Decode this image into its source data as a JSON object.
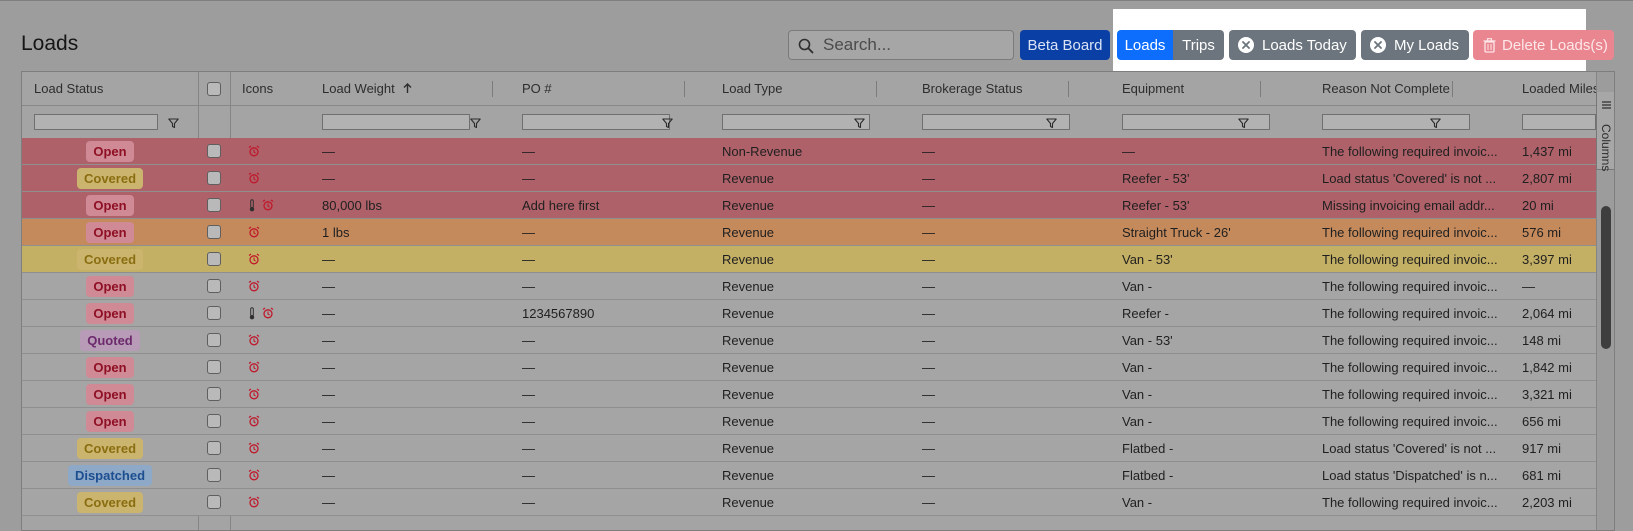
{
  "page": {
    "title": "Loads"
  },
  "search": {
    "placeholder": "Search..."
  },
  "toolbar": {
    "beta_board": "Beta Board",
    "segment": {
      "loads": "Loads",
      "trips": "Trips"
    },
    "loads_today": "Loads Today",
    "my_loads": "My Loads",
    "delete_loads": "Delete Loads(s)"
  },
  "grid": {
    "columns": {
      "load_status": "Load Status",
      "icons": "Icons",
      "load_weight": "Load Weight",
      "po": "PO #",
      "load_type": "Load Type",
      "brokerage_status": "Brokerage Status",
      "equipment": "Equipment",
      "reason_not_complete": "Reason Not Complete",
      "loaded_miles": "Loaded Miles"
    },
    "side_panel": "Columns",
    "rows": [
      {
        "status": "Open",
        "status_kind": "open",
        "bg": "#ae6169",
        "icons": [
          "alarm"
        ],
        "weight": "—",
        "po": "—",
        "load_type": "Non-Revenue",
        "brokerage": "—",
        "equipment": "—",
        "reason": "The following required invoic...",
        "miles": "1,437 mi"
      },
      {
        "status": "Covered",
        "status_kind": "covered",
        "bg": "#ae6169",
        "icons": [
          "alarm"
        ],
        "weight": "—",
        "po": "—",
        "load_type": "Revenue",
        "brokerage": "—",
        "equipment": "Reefer - 53'",
        "reason": "Load status 'Covered' is not ...",
        "miles": "2,807 mi"
      },
      {
        "status": "Open",
        "status_kind": "open",
        "bg": "#ae6169",
        "icons": [
          "thermometer",
          "alarm"
        ],
        "weight": "80,000 lbs",
        "po": "Add here first",
        "load_type": "Revenue",
        "brokerage": "—",
        "equipment": "Reefer - 53'",
        "reason": "Missing invoicing email addr...",
        "miles": "20 mi"
      },
      {
        "status": "Open",
        "status_kind": "open",
        "bg": "#c48a5c",
        "icons": [
          "alarm"
        ],
        "weight": "1 lbs",
        "po": "—",
        "load_type": "Revenue",
        "brokerage": "—",
        "equipment": "Straight Truck - 26'",
        "reason": "The following required invoic...",
        "miles": "576 mi"
      },
      {
        "status": "Covered",
        "status_kind": "covered",
        "bg": "#c4b064",
        "icons": [
          "alarm"
        ],
        "weight": "—",
        "po": "—",
        "load_type": "Revenue",
        "brokerage": "—",
        "equipment": "Van - 53'",
        "reason": "The following required invoic...",
        "miles": "3,397 mi"
      },
      {
        "status": "Open",
        "status_kind": "open",
        "bg": "#a5a5a5",
        "icons": [
          "alarm"
        ],
        "weight": "—",
        "po": "—",
        "load_type": "Revenue",
        "brokerage": "—",
        "equipment": "Van -",
        "reason": "The following required invoic...",
        "miles": "—"
      },
      {
        "status": "Open",
        "status_kind": "open",
        "bg": "#a5a5a5",
        "icons": [
          "thermometer",
          "alarm"
        ],
        "weight": "—",
        "po": "1234567890",
        "load_type": "Revenue",
        "brokerage": "—",
        "equipment": "Reefer -",
        "reason": "The following required invoic...",
        "miles": "2,064 mi"
      },
      {
        "status": "Quoted",
        "status_kind": "quoted",
        "bg": "#a5a5a5",
        "icons": [
          "alarm"
        ],
        "weight": "—",
        "po": "—",
        "load_type": "Revenue",
        "brokerage": "—",
        "equipment": "Van - 53'",
        "reason": "The following required invoic...",
        "miles": "148 mi"
      },
      {
        "status": "Open",
        "status_kind": "open",
        "bg": "#a5a5a5",
        "icons": [
          "alarm"
        ],
        "weight": "—",
        "po": "—",
        "load_type": "Revenue",
        "brokerage": "—",
        "equipment": "Van -",
        "reason": "The following required invoic...",
        "miles": "1,842 mi"
      },
      {
        "status": "Open",
        "status_kind": "open",
        "bg": "#a5a5a5",
        "icons": [
          "alarm"
        ],
        "weight": "—",
        "po": "—",
        "load_type": "Revenue",
        "brokerage": "—",
        "equipment": "Van -",
        "reason": "The following required invoic...",
        "miles": "3,321 mi"
      },
      {
        "status": "Open",
        "status_kind": "open",
        "bg": "#a5a5a5",
        "icons": [
          "alarm"
        ],
        "weight": "—",
        "po": "—",
        "load_type": "Revenue",
        "brokerage": "—",
        "equipment": "Van -",
        "reason": "The following required invoic...",
        "miles": "656 mi"
      },
      {
        "status": "Covered",
        "status_kind": "covered",
        "bg": "#a5a5a5",
        "icons": [
          "alarm"
        ],
        "weight": "—",
        "po": "—",
        "load_type": "Revenue",
        "brokerage": "—",
        "equipment": "Flatbed -",
        "reason": "Load status 'Covered' is not ...",
        "miles": "917 mi"
      },
      {
        "status": "Dispatched",
        "status_kind": "dispatched",
        "bg": "#a5a5a5",
        "icons": [
          "alarm"
        ],
        "weight": "—",
        "po": "—",
        "load_type": "Revenue",
        "brokerage": "—",
        "equipment": "Flatbed -",
        "reason": "Load status 'Dispatched' is n...",
        "miles": "681 mi"
      },
      {
        "status": "Covered",
        "status_kind": "covered",
        "bg": "#a5a5a5",
        "icons": [
          "alarm"
        ],
        "weight": "—",
        "po": "—",
        "load_type": "Revenue",
        "brokerage": "—",
        "equipment": "Van -",
        "reason": "The following required invoic...",
        "miles": "2,203 mi"
      }
    ]
  }
}
